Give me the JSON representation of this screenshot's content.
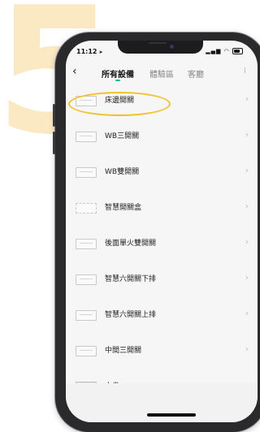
{
  "background": {
    "large_number": "5",
    "number_color": "#fbe9c4",
    "highlight_color": "#f1c22e"
  },
  "status_bar": {
    "time": "11:12",
    "location_icon": "location-arrow-icon"
  },
  "nav": {
    "back_icon": "chevron-left-icon",
    "tabs": [
      {
        "label": "所有設備",
        "active": true
      },
      {
        "label": "體驗區",
        "active": false
      },
      {
        "label": "客廳",
        "active": false
      }
    ],
    "accent_color": "#19b58c"
  },
  "devices": [
    {
      "label": "床邊開關",
      "icon": "switch-icon"
    },
    {
      "label": "WB三開關",
      "icon": "switch-icon"
    },
    {
      "label": "WB雙開關",
      "icon": "switch-icon"
    },
    {
      "label": "智慧開關盒",
      "icon": "switch-box-icon"
    },
    {
      "label": "後面單火雙開關",
      "icon": "switch-icon"
    },
    {
      "label": "智慧六開關下排",
      "icon": "switch-icon"
    },
    {
      "label": "智慧六開關上排",
      "icon": "switch-icon"
    },
    {
      "label": "中間三開關",
      "icon": "switch-icon"
    },
    {
      "label": "小卷",
      "icon": "curtain-icon"
    }
  ]
}
